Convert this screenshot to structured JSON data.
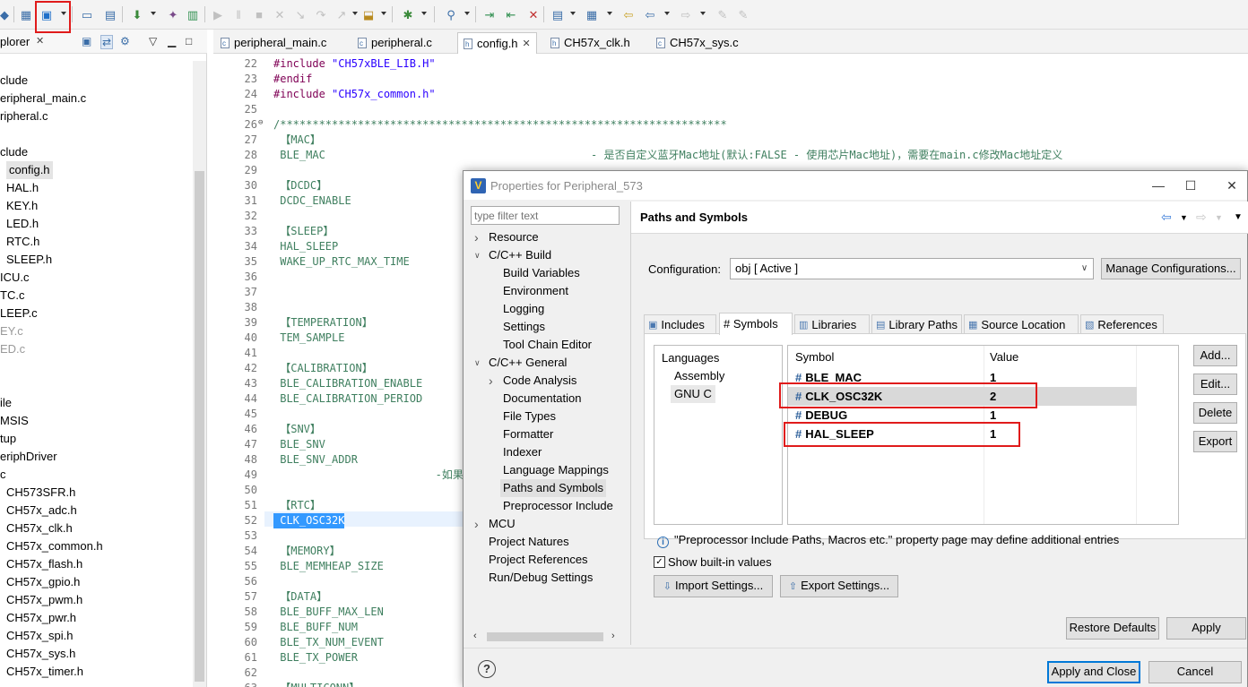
{
  "explorer": {
    "tab_label": "plorer",
    "tree": [
      {
        "label": "clude",
        "x": 0
      },
      {
        "label": "eripheral_main.c",
        "x": 0
      },
      {
        "label": "ripheral.c",
        "x": 0
      },
      {
        "label": "",
        "x": 0
      },
      {
        "label": "clude",
        "x": 0
      },
      {
        "label": "config.h",
        "x": 7,
        "selected": true
      },
      {
        "label": "HAL.h",
        "x": 7
      },
      {
        "label": "KEY.h",
        "x": 7
      },
      {
        "label": "LED.h",
        "x": 7
      },
      {
        "label": "RTC.h",
        "x": 7
      },
      {
        "label": "SLEEP.h",
        "x": 7
      },
      {
        "label": "ICU.c",
        "x": 0
      },
      {
        "label": "TC.c",
        "x": 0
      },
      {
        "label": "LEEP.c",
        "x": 0
      },
      {
        "label": "EY.c",
        "x": 0,
        "dim": true
      },
      {
        "label": "ED.c",
        "x": 0,
        "dim": true
      },
      {
        "label": "",
        "x": 0
      },
      {
        "label": "",
        "x": 0
      },
      {
        "label": "ile",
        "x": 0
      },
      {
        "label": "MSIS",
        "x": 0
      },
      {
        "label": "tup",
        "x": 0
      },
      {
        "label": "eriphDriver",
        "x": 0
      },
      {
        "label": "c",
        "x": 0
      },
      {
        "label": "CH573SFR.h",
        "x": 7
      },
      {
        "label": "CH57x_adc.h",
        "x": 7
      },
      {
        "label": "CH57x_clk.h",
        "x": 7
      },
      {
        "label": "CH57x_common.h",
        "x": 7
      },
      {
        "label": "CH57x_flash.h",
        "x": 7
      },
      {
        "label": "CH57x_gpio.h",
        "x": 7
      },
      {
        "label": "CH57x_pwm.h",
        "x": 7
      },
      {
        "label": "CH57x_pwr.h",
        "x": 7
      },
      {
        "label": "CH57x_spi.h",
        "x": 7
      },
      {
        "label": "CH57x_sys.h",
        "x": 7
      },
      {
        "label": "CH57x_timer.h",
        "x": 7
      }
    ]
  },
  "editor_tabs": [
    {
      "label": "peripheral_main.c",
      "type": "c"
    },
    {
      "label": "peripheral.c",
      "type": "c"
    },
    {
      "label": "config.h",
      "type": "h",
      "active": true
    },
    {
      "label": "CH57x_clk.h",
      "type": "h"
    },
    {
      "label": "CH57x_sys.c",
      "type": "c"
    }
  ],
  "editor_lines": [
    {
      "n": "22",
      "text": "#include \"CH57xBLE_LIB.H\"",
      "kind": "inc"
    },
    {
      "n": "23",
      "text": "#endif",
      "kind": "kw"
    },
    {
      "n": "24",
      "text": "#include \"CH57x_common.h\"",
      "kind": "inc"
    },
    {
      "n": "25",
      "text": "",
      "kind": "plain"
    },
    {
      "n": "26",
      "text": "/*********************************************************************",
      "kind": "cm"
    },
    {
      "n": "27",
      "text": " 【MAC】",
      "kind": "cm"
    },
    {
      "n": "28",
      "text": " BLE_MAC                                         - 是否自定义蓝牙Mac地址(默认:FALSE - 使用芯片Mac地址)，需要在main.c修改Mac地址定义",
      "kind": "cm"
    },
    {
      "n": "29",
      "text": "",
      "kind": "plain"
    },
    {
      "n": "30",
      "text": " 【DCDC】",
      "kind": "cm"
    },
    {
      "n": "31",
      "text": " DCDC_ENABLE",
      "kind": "cm"
    },
    {
      "n": "32",
      "text": "",
      "kind": "plain"
    },
    {
      "n": "33",
      "text": " 【SLEEP】",
      "kind": "cm"
    },
    {
      "n": "34",
      "text": " HAL_SLEEP",
      "kind": "cm"
    },
    {
      "n": "35",
      "text": " WAKE_UP_RTC_MAX_TIME",
      "kind": "cm"
    },
    {
      "n": "36",
      "text": "",
      "kind": "plain"
    },
    {
      "n": "37",
      "text": "",
      "kind": "plain"
    },
    {
      "n": "38",
      "text": "",
      "kind": "plain"
    },
    {
      "n": "39",
      "text": " 【TEMPERATION】",
      "kind": "cm"
    },
    {
      "n": "40",
      "text": " TEM_SAMPLE",
      "kind": "cm"
    },
    {
      "n": "41",
      "text": "",
      "kind": "plain"
    },
    {
      "n": "42",
      "text": " 【CALIBRATION】",
      "kind": "cm"
    },
    {
      "n": "43",
      "text": " BLE_CALIBRATION_ENABLE",
      "kind": "cm"
    },
    {
      "n": "44",
      "text": " BLE_CALIBRATION_PERIOD",
      "kind": "cm"
    },
    {
      "n": "45",
      "text": "",
      "kind": "plain"
    },
    {
      "n": "46",
      "text": " 【SNV】",
      "kind": "cm"
    },
    {
      "n": "47",
      "text": " BLE_SNV",
      "kind": "cm"
    },
    {
      "n": "48",
      "text": " BLE_SNV_ADDR",
      "kind": "cm"
    },
    {
      "n": "49",
      "text": "                         -如果配置了S",
      "kind": "cm"
    },
    {
      "n": "50",
      "text": "",
      "kind": "plain"
    },
    {
      "n": "51",
      "text": " 【RTC】",
      "kind": "cm"
    },
    {
      "n": "52",
      "text": " CLK_OSC32K",
      "kind": "selected"
    },
    {
      "n": "53",
      "text": "",
      "kind": "plain"
    },
    {
      "n": "54",
      "text": " 【MEMORY】",
      "kind": "cm"
    },
    {
      "n": "55",
      "text": " BLE_MEMHEAP_SIZE",
      "kind": "cm"
    },
    {
      "n": "56",
      "text": "",
      "kind": "plain"
    },
    {
      "n": "57",
      "text": " 【DATA】",
      "kind": "cm"
    },
    {
      "n": "58",
      "text": " BLE_BUFF_MAX_LEN",
      "kind": "cm"
    },
    {
      "n": "59",
      "text": " BLE_BUFF_NUM",
      "kind": "cm"
    },
    {
      "n": "60",
      "text": " BLE_TX_NUM_EVENT",
      "kind": "cm"
    },
    {
      "n": "61",
      "text": " BLE_TX_POWER",
      "kind": "cm"
    },
    {
      "n": "62",
      "text": "",
      "kind": "plain"
    },
    {
      "n": "63",
      "text": " 【MULTICONN】",
      "kind": "cm"
    }
  ],
  "dialog": {
    "title": "Properties for Peripheral_573",
    "filter_placeholder": "type filter text",
    "nav": [
      {
        "label": "Resource",
        "indent": 1,
        "arrow": "right"
      },
      {
        "label": "C/C++ Build",
        "indent": 1,
        "arrow": "down"
      },
      {
        "label": "Build Variables",
        "indent": 2
      },
      {
        "label": "Environment",
        "indent": 2
      },
      {
        "label": "Logging",
        "indent": 2
      },
      {
        "label": "Settings",
        "indent": 2
      },
      {
        "label": "Tool Chain Editor",
        "indent": 2
      },
      {
        "label": "C/C++ General",
        "indent": 1,
        "arrow": "down"
      },
      {
        "label": "Code Analysis",
        "indent": 2,
        "arrow": "right"
      },
      {
        "label": "Documentation",
        "indent": 2
      },
      {
        "label": "File Types",
        "indent": 2
      },
      {
        "label": "Formatter",
        "indent": 2
      },
      {
        "label": "Indexer",
        "indent": 2
      },
      {
        "label": "Language Mappings",
        "indent": 2
      },
      {
        "label": "Paths and Symbols",
        "indent": 2,
        "selected": true
      },
      {
        "label": "Preprocessor Include",
        "indent": 2
      },
      {
        "label": "MCU",
        "indent": 1,
        "arrow": "right"
      },
      {
        "label": "Project Natures",
        "indent": 1
      },
      {
        "label": "Project References",
        "indent": 1
      },
      {
        "label": "Run/Debug Settings",
        "indent": 1
      }
    ],
    "page_title": "Paths and Symbols",
    "config_label": "Configuration:",
    "config_value": "obj  [ Active ]",
    "manage_button": "Manage Configurations...",
    "tabs": [
      {
        "label": "Includes",
        "icon": "includes-icon"
      },
      {
        "label": "# Symbols",
        "icon": "",
        "active": true
      },
      {
        "label": "Libraries",
        "icon": "libraries-icon"
      },
      {
        "label": "Library Paths",
        "icon": "library-paths-icon"
      },
      {
        "label": "Source Location",
        "icon": "source-location-icon"
      },
      {
        "label": "References",
        "icon": "references-icon"
      }
    ],
    "languages_header": "Languages",
    "languages": [
      {
        "label": "Assembly"
      },
      {
        "label": "GNU C",
        "selected": true
      }
    ],
    "symbol_header": "Symbol",
    "value_header": "Value",
    "symbols": [
      {
        "name": "BLE_MAC",
        "value": "1"
      },
      {
        "name": "CLK_OSC32K",
        "value": "2",
        "selected": true
      },
      {
        "name": "DEBUG",
        "value": "1"
      },
      {
        "name": "HAL_SLEEP",
        "value": "1"
      }
    ],
    "side_buttons": [
      "Add...",
      "Edit...",
      "Delete",
      "Export"
    ],
    "info_text": "\"Preprocessor Include Paths, Macros etc.\" property page may define additional entries",
    "show_builtin_label": "Show built-in values",
    "import_button": "Import Settings...",
    "export_button": "Export Settings...",
    "restore_button": "Restore Defaults",
    "apply_button": "Apply",
    "apply_close_button": "Apply and Close",
    "cancel_button": "Cancel"
  }
}
